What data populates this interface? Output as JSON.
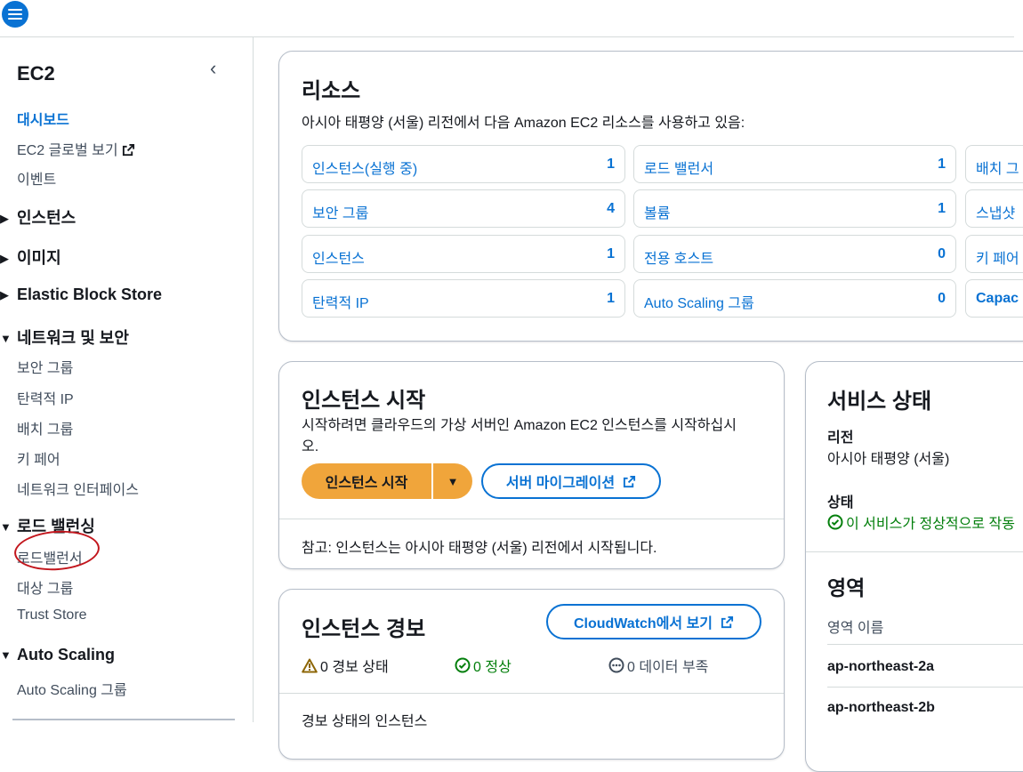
{
  "sidebar": {
    "title": "EC2",
    "collapse_glyph": "‹",
    "links": [
      {
        "label": "대시보드"
      },
      {
        "label": "EC2 글로벌 보기"
      },
      {
        "label": "이벤트"
      }
    ],
    "sections": [
      {
        "label": "인스턴스",
        "caret": "▶"
      },
      {
        "label": "이미지",
        "caret": "▶"
      },
      {
        "label": "Elastic Block Store",
        "caret": "▶"
      },
      {
        "label": "네트워크 및 보안",
        "caret": "▼"
      },
      {
        "label": "로드 밸런싱",
        "caret": "▼"
      },
      {
        "label": "Auto Scaling",
        "caret": "▼"
      }
    ],
    "network_items": [
      "보안 그룹",
      "탄력적 IP",
      "배치 그룹",
      "키 페어",
      "네트워크 인터페이스"
    ],
    "lb_items": [
      "로드밸런서",
      "대상 그룹",
      "Trust Store"
    ],
    "as_items": [
      "Auto Scaling 그룹"
    ]
  },
  "resources": {
    "title": "리소스",
    "subtitle": "아시아 태평양 (서울) 리전에서 다음 Amazon EC2 리소스를 사용하고 있음:",
    "col1": [
      {
        "label": "인스턴스(실행 중)",
        "count": "1"
      },
      {
        "label": "보안 그룹",
        "count": "4"
      },
      {
        "label": "인스턴스",
        "count": "1"
      },
      {
        "label": "탄력적 IP",
        "count": "1"
      }
    ],
    "col2": [
      {
        "label": "로드 밸런서",
        "count": "1"
      },
      {
        "label": "볼륨",
        "count": "1"
      },
      {
        "label": "전용 호스트",
        "count": "0"
      },
      {
        "label": "Auto Scaling 그룹",
        "count": "0"
      }
    ],
    "col3": [
      {
        "label": "배치 그"
      },
      {
        "label": "스냅샷"
      },
      {
        "label": "키 페어"
      },
      {
        "label": "Capac"
      }
    ]
  },
  "launch": {
    "title": "인스턴스 시작",
    "desc_line1": "시작하려면 클라우드의 가상 서버인 Amazon EC2 인스턴스를 시작하십시",
    "desc_line2": "오.",
    "launch_button": "인스턴스 시작",
    "dropdown_glyph": "▼",
    "migrate_button": "서버 마이그레이션",
    "note": "참고: 인스턴스는 아시아 태평양 (서울) 리전에서 시작됩니다."
  },
  "alarms": {
    "title": "인스턴스 경보",
    "cloudwatch_button": "CloudWatch에서 보기",
    "alarm_state": "0 경보 상태",
    "ok_state": "0 정상",
    "insufficient": "0 데이터 부족",
    "footer_link": "경보 상태의 인스턴스",
    "colors": {
      "alarm": "#8d6605",
      "ok": "#037f0c",
      "insufficient": "#414d5c"
    }
  },
  "service": {
    "title": "서비스 상태",
    "region_label": "리전",
    "region_value": "아시아 태평양 (서울)",
    "status_label": "상태",
    "status_value": "이 서비스가 정상적으로 작동",
    "zones_title": "영역",
    "zone_header": "영역 이름",
    "zones": [
      "ap-northeast-2a",
      "ap-northeast-2b"
    ]
  },
  "colors": {
    "accent": "#0972d3",
    "primary_button": "#f0a53b",
    "ok": "#037f0c",
    "annotation": "#c2161d"
  }
}
